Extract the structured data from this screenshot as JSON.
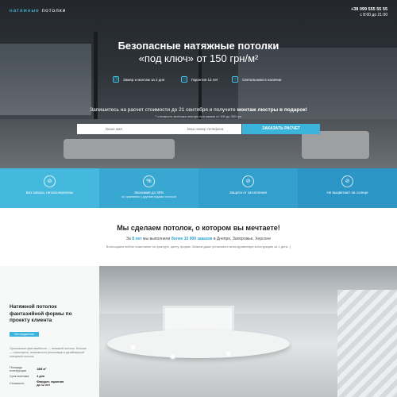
{
  "header": {
    "logo_accent": "натяжные",
    "logo_rest": " потолки",
    "phone": "+38 099 555 55 55",
    "hours": "с 8:00 до 21:00"
  },
  "hero": {
    "title_line1": "Безопасные натяжные потолки",
    "title_line2": "«под ключ» от 150 грн/м²",
    "features": [
      {
        "icon": "clock-icon",
        "label": "Замер и монтаж за 2 дня"
      },
      {
        "icon": "shield-icon",
        "label": "Гарантия 12 лет"
      },
      {
        "icon": "lamp-icon",
        "label": "Светильники в наличии"
      }
    ],
    "offer_text": "Запишитесь на расчет стоимости до 21 сентября и получите ",
    "offer_bold": "монтаж люстры в подарок!",
    "offer_note": "* стоимость монтажа люстры при заказе от 100 до 300 грн",
    "name_placeholder": "Ваше имя",
    "phone_placeholder": "Ваш номер телефона",
    "cta_label": "ЗАКАЗАТЬ РАСЧЕТ"
  },
  "benefits": [
    {
      "icon": "no-smell-icon",
      "title": "Без запаха, гипоаллергенны",
      "sub": "",
      "color": "#45b9dd"
    },
    {
      "icon": "percent-icon",
      "title": "Экономия до 30%",
      "sub": "по сравнению с другими видами потолков",
      "color": "#38a8d3"
    },
    {
      "icon": "no-water-icon",
      "title": "Защита от затопления",
      "sub": "",
      "color": "#329fcc"
    },
    {
      "icon": "no-sun-icon",
      "title": "Не выцветают на солнце",
      "sub": "",
      "color": "#2b95c5"
    }
  ],
  "intro": {
    "title": "Мы сделаем потолок, о котором вы мечтаете!",
    "sub_pre": "За ",
    "sub_years": "8 лет",
    "sub_mid": " мы выполнили ",
    "sub_orders": "более 15 000 заказов",
    "sub_post": " в Днепре, Запорожье, Херсоне",
    "sub2": "Воплощаем любое пожелание по фактуре, цвету, форме. Можем даже установить многоуровневую конструкцию за 1 день :)"
  },
  "project": {
    "title": "Натяжной потолок фантазийной формы по проекту клиента",
    "tag": "Нестандартная",
    "desc": "Оригинально фантазийность — натяжной потолок. Больше — гипсокартон, возможность реализации в дизайнерской глянцевой потолок",
    "specs": [
      {
        "label": "Площадь конструкции",
        "value": "18М м²"
      },
      {
        "label": "Срок монтажа",
        "value": "4 дня"
      },
      {
        "label": "Стоимость",
        "value": "Фаворит, гарантия до 12 лет"
      }
    ]
  },
  "colors": {
    "accent": "#3bb4dc",
    "hero_dark": "#2b3035"
  }
}
